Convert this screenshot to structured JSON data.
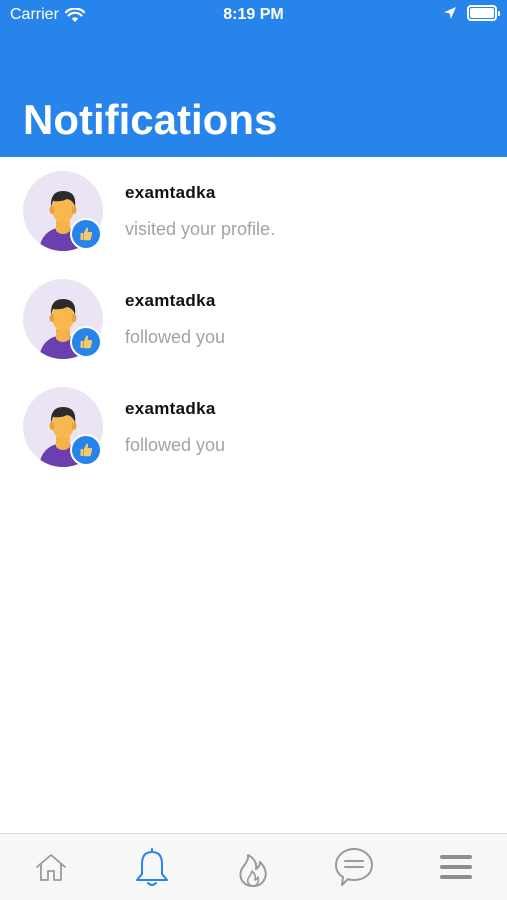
{
  "status_bar": {
    "carrier": "Carrier",
    "time": "8:19 PM",
    "battery_level": 1.0
  },
  "header": {
    "title": "Notifications",
    "color": "#2784ea"
  },
  "notifications": [
    {
      "user": "examtadka",
      "text": "visited your profile.",
      "avatar_icon": "user-avatar-icon",
      "badge_icon": "thumbs-up-icon"
    },
    {
      "user": "examtadka",
      "text": "followed you",
      "avatar_icon": "user-avatar-icon",
      "badge_icon": "thumbs-up-icon"
    },
    {
      "user": "examtadka",
      "text": "followed you",
      "avatar_icon": "user-avatar-icon",
      "badge_icon": "thumbs-up-icon"
    }
  ],
  "tab_bar": {
    "active": "notifications",
    "active_color": "#2784ea",
    "tabs": [
      {
        "id": "home",
        "icon": "home-icon"
      },
      {
        "id": "notifications",
        "icon": "bell-icon"
      },
      {
        "id": "trending",
        "icon": "flame-icon"
      },
      {
        "id": "messages",
        "icon": "chat-bubble-icon"
      },
      {
        "id": "menu",
        "icon": "menu-icon"
      }
    ]
  }
}
